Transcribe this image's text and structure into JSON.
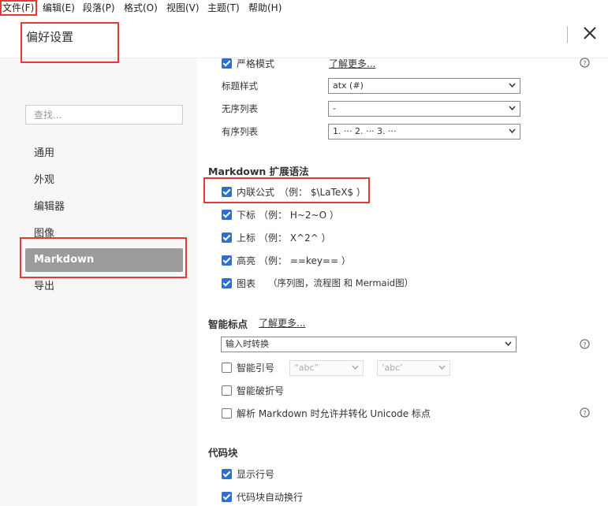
{
  "menu": [
    "文件(F)",
    "编辑(E)",
    "段落(P)",
    "格式(O)",
    "视图(V)",
    "主题(T)",
    "帮助(H)"
  ],
  "header": {
    "title": "偏好设置"
  },
  "sidebar": {
    "search_placeholder": "查找...",
    "items": [
      "通用",
      "外观",
      "编辑器",
      "图像",
      "Markdown",
      "导出"
    ],
    "active": "Markdown"
  },
  "markdown_syntax": {
    "strict_mode": {
      "label": "严格模式",
      "checked": true,
      "link": "了解更多..."
    },
    "heading_style": {
      "label": "标题样式",
      "value": "atx (#)"
    },
    "unordered_list": {
      "label": "无序列表",
      "value": "-"
    },
    "ordered_list": {
      "label": "有序列表",
      "value": "1. ··· 2. ··· 3. ···"
    }
  },
  "extensions": {
    "title": "Markdown 扩展语法",
    "items": [
      {
        "label": "内联公式",
        "example": "（例： $\\LaTeX$ ）",
        "checked": true
      },
      {
        "label": "下标",
        "example": "（例： H~2~O ）",
        "checked": true
      },
      {
        "label": "上标",
        "example": "（例： X^2^ ）",
        "checked": true
      },
      {
        "label": "高亮",
        "example": "（例： ==key== ）",
        "checked": true
      },
      {
        "label": "图表",
        "example": "（序列图，流程图 和 Mermaid图）",
        "checked": true
      }
    ]
  },
  "smart_punct": {
    "title": "智能标点",
    "link": "了解更多...",
    "mode": "输入时转换",
    "smart_quotes": {
      "label": "智能引号",
      "checked": false,
      "double": "“abc”",
      "single": "‘abc’"
    },
    "smart_dash": {
      "label": "智能破折号",
      "checked": false
    },
    "unicode": {
      "label": "解析 Markdown 时允许并转化 Unicode 标点",
      "checked": false
    }
  },
  "code_block": {
    "title": "代码块",
    "line_numbers": {
      "label": "显示行号",
      "checked": true
    },
    "wrap": {
      "label": "代码块自动换行",
      "checked": true
    }
  },
  "colors": {
    "accent": "#2f6fce",
    "highlight_box": "#e53935",
    "active_nav": "#9b9b9b"
  }
}
